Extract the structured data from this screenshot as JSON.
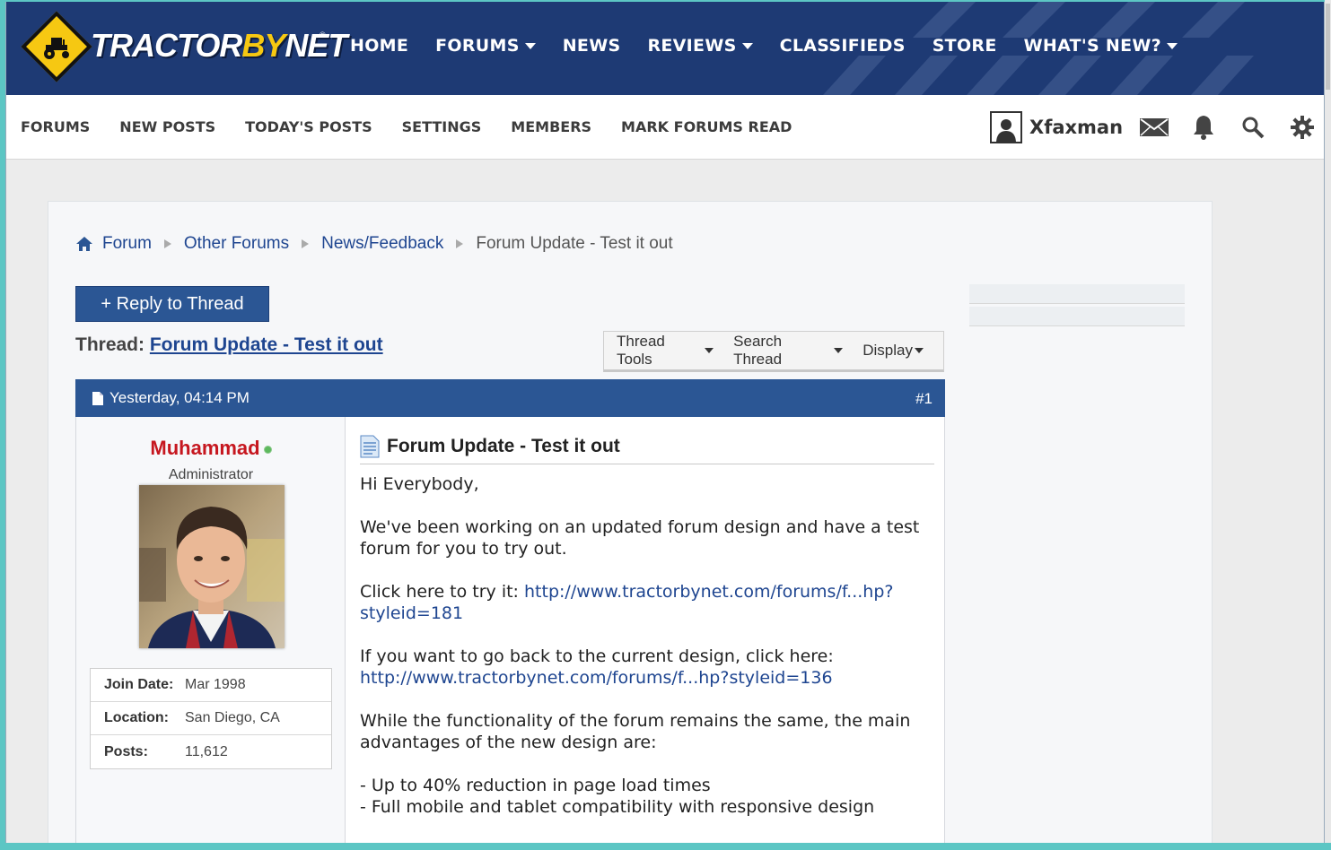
{
  "brand": {
    "name_a": "TRACTOR",
    "name_b": "BY",
    "name_c": "NET",
    "tm": "®"
  },
  "topnav": {
    "home": "HOME",
    "forums": "FORUMS",
    "news": "NEWS",
    "reviews": "REVIEWS",
    "classifieds": "CLASSIFIEDS",
    "store": "STORE",
    "whats_new": "WHAT'S NEW?"
  },
  "subnav": {
    "forums": "FORUMS",
    "new_posts": "NEW POSTS",
    "todays_posts": "TODAY'S POSTS",
    "settings": "SETTINGS",
    "members": "MEMBERS",
    "mark_read": "MARK FORUMS READ",
    "username": "Xfaxman"
  },
  "breadcrumb": {
    "items": [
      "Forum",
      "Other Forums",
      "News/Feedback"
    ],
    "current": "Forum Update - Test it out"
  },
  "thread": {
    "reply_label": "+ Reply to Thread",
    "label": "Thread:",
    "title": "Forum Update - Test it out",
    "tools": [
      "Thread Tools",
      "Search Thread",
      "Display"
    ]
  },
  "post": {
    "date": "Yesterday, 04:14 PM",
    "number": "#1",
    "author": "Muhammad",
    "author_title": "Administrator",
    "stats": [
      {
        "k": "Join Date:",
        "v": "Mar 1998"
      },
      {
        "k": "Location:",
        "v": "San Diego, CA"
      },
      {
        "k": "Posts:",
        "v": "11,612"
      }
    ],
    "title": "Forum Update - Test it out",
    "greeting": "Hi Everybody,",
    "p1": "We've been working on an updated forum design and have a test forum for you to try out.",
    "p2_text": "Click here to try it:",
    "p2_link": "http://www.tractorbynet.com/forums/f...hp?styleid=181",
    "p3_text": "If you want to go back to the current design, click here:",
    "p3_link": "http://www.tractorbynet.com/forums/f...hp?styleid=136",
    "p4": "While the functionality of the forum remains the same, the main advantages of the new design are:",
    "bullet1": "- Up to 40% reduction in page load times",
    "bullet2": "- Full mobile and tablet compatibility with responsive design"
  },
  "colors": {
    "header_bg": "#1e3a74",
    "accent_blue": "#2b5694",
    "logo_yellow": "#f6c812",
    "author_red": "#c6171f"
  },
  "icons": [
    "tractor-logo-icon",
    "caret-down-icon",
    "user-icon",
    "envelope-icon",
    "bell-icon",
    "search-icon",
    "gear-icon",
    "home-icon",
    "document-icon"
  ]
}
